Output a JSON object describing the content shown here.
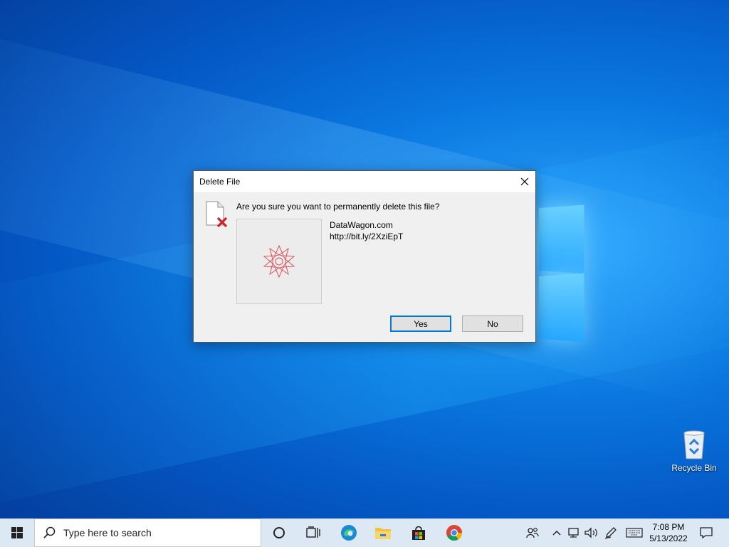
{
  "dialog": {
    "title": "Delete File",
    "question": "Are you sure you want to permanently delete this file?",
    "file_name": "DataWagon.com",
    "file_url": "http://bit.ly/2XziEpT",
    "yes_label": "Yes",
    "no_label": "No"
  },
  "desktop": {
    "recycle_bin_label": "Recycle Bin"
  },
  "taskbar": {
    "search_placeholder": "Type here to search",
    "time": "7:08 PM",
    "date": "5/13/2022",
    "pinned": [
      "cortana-icon",
      "task-view-icon",
      "edge-icon",
      "file-explorer-icon",
      "store-icon",
      "chrome-icon"
    ],
    "tray_icons": [
      "people-icon",
      "chevron-up-icon",
      "network-icon",
      "volume-icon",
      "pen-icon",
      "keyboard-icon",
      "notifications-icon"
    ]
  },
  "colors": {
    "accent": "#0078d7",
    "taskbar": "#dce8f4",
    "delete_mark": "#d0202a"
  }
}
